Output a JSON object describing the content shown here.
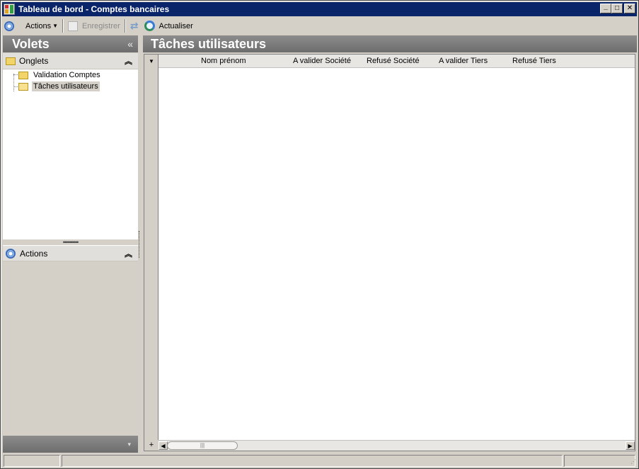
{
  "window": {
    "title": "Tableau de bord - Comptes bancaires",
    "minimize": "_",
    "maximize": "□",
    "close": "✕"
  },
  "toolbar": {
    "actions_label": "Actions",
    "save_label": "Enregistrer",
    "refresh_label": "Actualiser"
  },
  "left_pane": {
    "title": "Volets",
    "collapse_glyph": "«",
    "onglets_group": {
      "label": "Onglets",
      "toggle_glyph": "⌃",
      "items": [
        {
          "label": "Validation Comptes",
          "selected": false
        },
        {
          "label": "Tâches utilisateurs",
          "selected": true
        }
      ]
    },
    "actions_group": {
      "label": "Actions",
      "toggle_glyph": "⌃"
    },
    "splitter_grip": "••••••••••",
    "bottom_glyph": "▾"
  },
  "right_pane": {
    "title": "Tâches utilisateurs",
    "grid": {
      "columns": [
        "Nom prénom",
        "A valider Société",
        "Refusé Société",
        "A valider Tiers",
        "Refusé Tiers"
      ],
      "corner_glyph": "▼",
      "add_glyph": "+",
      "scroll_left": "◀",
      "scroll_right": "▶",
      "thumb_grip": "|||"
    }
  },
  "colors": {
    "titlebar": "#0a246a",
    "pane_header": "#7d7d7d",
    "chrome": "#d4d0c8"
  }
}
